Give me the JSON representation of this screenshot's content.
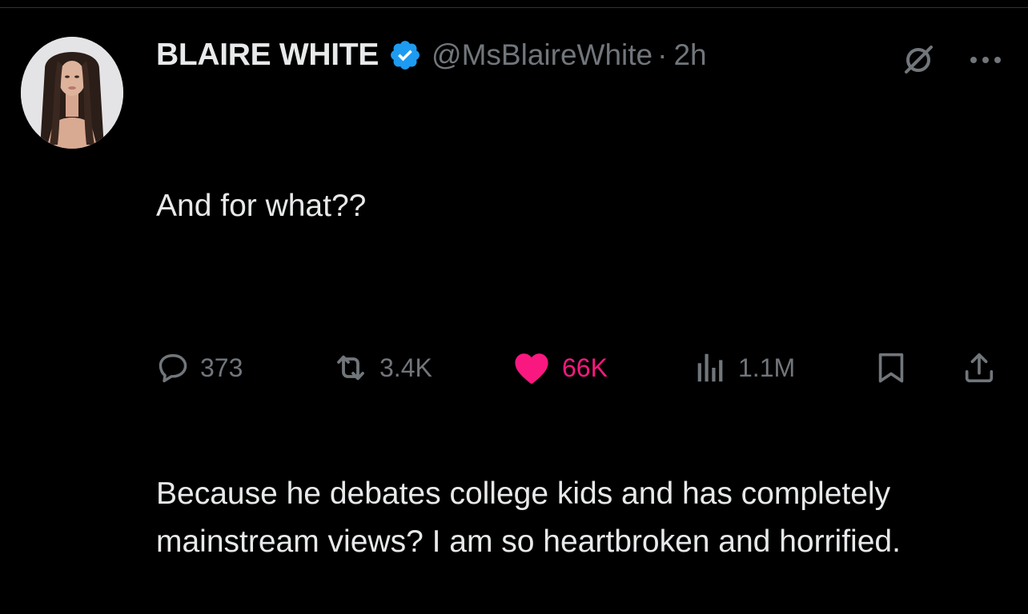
{
  "tweet": {
    "author": {
      "display_name": "BLAIRE WHITE",
      "handle": "@MsBlaireWhite",
      "verified": true,
      "avatar_icon": "profile-photo"
    },
    "separator": "·",
    "time": "2h",
    "text_paragraphs": [
      "And for what??",
      "Because he debates college kids and has completely mainstream views? I am so heartbroken and horrified."
    ],
    "actions": {
      "reply": {
        "icon": "reply-bubble-icon",
        "count": "373"
      },
      "repost": {
        "icon": "repost-icon",
        "count": "3.4K"
      },
      "like": {
        "icon": "heart-icon",
        "count": "66K",
        "liked": true
      },
      "views": {
        "icon": "analytics-bars-icon",
        "count": "1.1M"
      },
      "bookmark": {
        "icon": "bookmark-icon"
      },
      "share": {
        "icon": "share-icon"
      }
    },
    "top_right": {
      "grok_icon": "grok-slash-icon",
      "more_icon": "more-dots-icon"
    }
  },
  "colors": {
    "background": "#000000",
    "primary_text": "#e7e9ea",
    "secondary_text": "#71767b",
    "verified_blue": "#1d9bf0",
    "like_pink": "#f91880",
    "divider": "#2f3336"
  }
}
